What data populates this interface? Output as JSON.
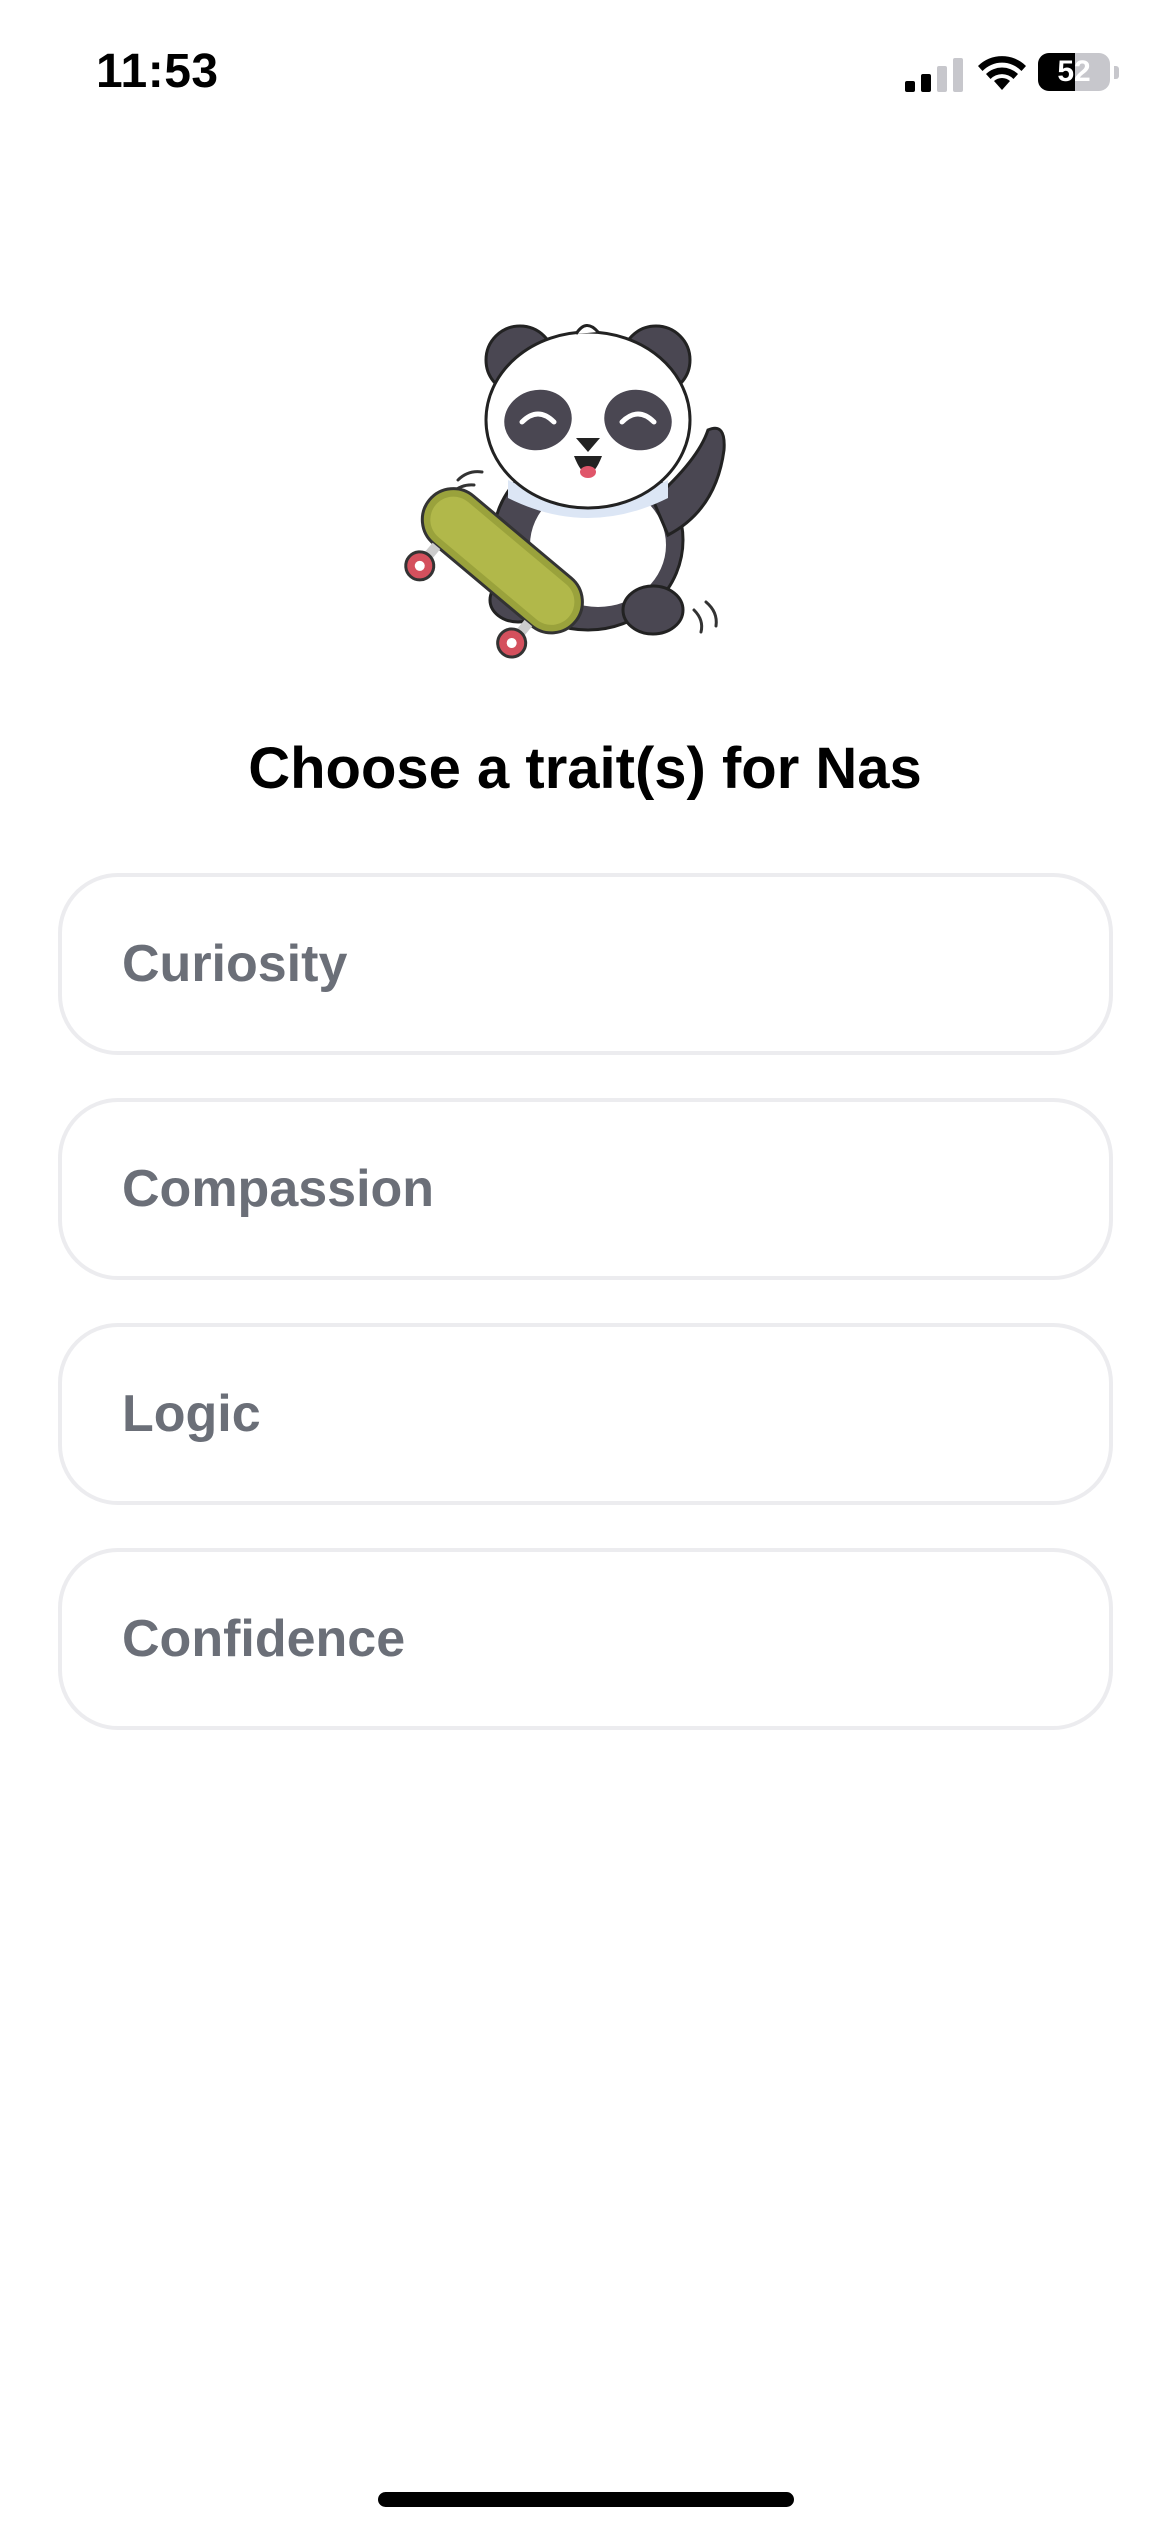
{
  "status_bar": {
    "time": "11:53",
    "battery_level": "52",
    "battery_fraction": 0.52,
    "signal_bars_active": 2,
    "signal_bars_total": 4
  },
  "mascot": {
    "icon": "skateboarding-panda-illustration"
  },
  "title": "Choose a trait(s) for Nas",
  "traits": [
    {
      "label": "Curiosity"
    },
    {
      "label": "Compassion"
    },
    {
      "label": "Logic"
    },
    {
      "label": "Confidence"
    }
  ],
  "colors": {
    "option_border": "#ececef",
    "option_text": "#6b6f78",
    "title_text": "#000000",
    "background": "#ffffff"
  }
}
